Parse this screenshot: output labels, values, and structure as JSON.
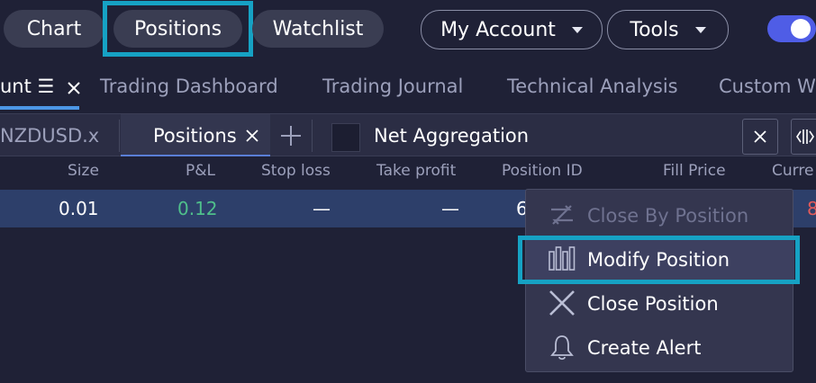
{
  "top_nav": {
    "chart": "Chart",
    "positions": "Positions",
    "watchlist": "Watchlist",
    "my_account": "My Account",
    "tools": "Tools"
  },
  "workspace_tabs": {
    "account_fragment": "unt ☰",
    "trading_dashboard": "Trading Dashboard",
    "trading_journal": "Trading Journal",
    "technical_analysis": "Technical Analysis",
    "custom": "Custom W"
  },
  "sub_tabs": {
    "symbol_tab": "NZDUSD.x",
    "positions_tab": "Positions",
    "net_aggregation": "Net Aggregation"
  },
  "columns": [
    "Size",
    "P&L",
    "Stop loss",
    "Take profit",
    "Position ID",
    "Fill Price",
    "Curre"
  ],
  "row": {
    "size": "0.01",
    "pnl": "0.12",
    "stop_loss": "—",
    "take_profit": "—",
    "position_id": "6",
    "current": "8"
  },
  "context_menu": {
    "close_by_position": "Close By Position",
    "modify_position": "Modify Position",
    "close_position": "Close Position",
    "create_alert": "Create Alert"
  },
  "colors": {
    "accent_highlight": "#16a2c4",
    "positive": "#4fbf8b",
    "negative": "#e35a5a",
    "toggle": "#4f5de6"
  }
}
